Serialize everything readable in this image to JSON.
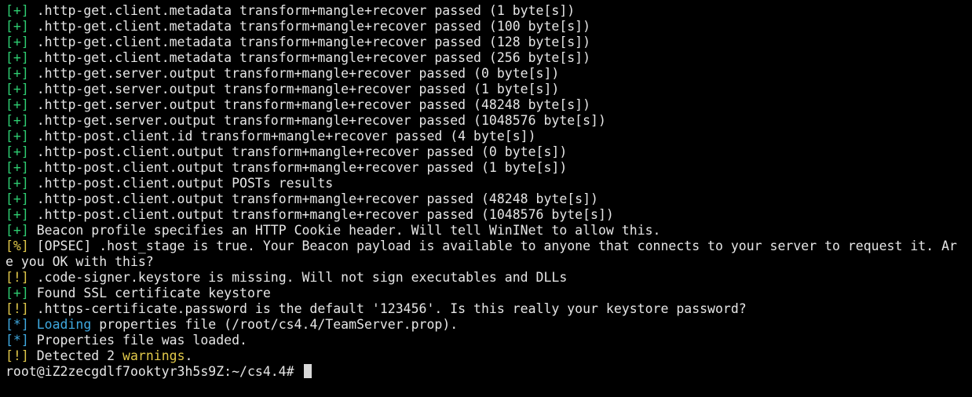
{
  "colors": {
    "background": "#000000",
    "text": "#e6e6e6",
    "plus_tag": "#2ecc71",
    "warning_tag": "#e0c84a",
    "info_tag": "#3fa9e0"
  },
  "lines": [
    {
      "tag": "[+]",
      "text": " .http-get.client.metadata transform+mangle+recover passed (1 byte[s])"
    },
    {
      "tag": "[+]",
      "text": " .http-get.client.metadata transform+mangle+recover passed (100 byte[s])"
    },
    {
      "tag": "[+]",
      "text": " .http-get.client.metadata transform+mangle+recover passed (128 byte[s])"
    },
    {
      "tag": "[+]",
      "text": " .http-get.client.metadata transform+mangle+recover passed (256 byte[s])"
    },
    {
      "tag": "[+]",
      "text": " .http-get.server.output transform+mangle+recover passed (0 byte[s])"
    },
    {
      "tag": "[+]",
      "text": " .http-get.server.output transform+mangle+recover passed (1 byte[s])"
    },
    {
      "tag": "[+]",
      "text": " .http-get.server.output transform+mangle+recover passed (48248 byte[s])"
    },
    {
      "tag": "[+]",
      "text": " .http-get.server.output transform+mangle+recover passed (1048576 byte[s])"
    },
    {
      "tag": "[+]",
      "text": " .http-post.client.id transform+mangle+recover passed (4 byte[s])"
    },
    {
      "tag": "[+]",
      "text": " .http-post.client.output transform+mangle+recover passed (0 byte[s])"
    },
    {
      "tag": "[+]",
      "text": " .http-post.client.output transform+mangle+recover passed (1 byte[s])"
    },
    {
      "tag": "[+]",
      "text": " .http-post.client.output POSTs results"
    },
    {
      "tag": "[+]",
      "text": " .http-post.client.output transform+mangle+recover passed (48248 byte[s])"
    },
    {
      "tag": "[+]",
      "text": " .http-post.client.output transform+mangle+recover passed (1048576 byte[s])"
    },
    {
      "tag": "[+]",
      "text": " Beacon profile specifies an HTTP Cookie header. Will tell WinINet to allow this."
    },
    {
      "tag": "[%]",
      "text": " [OPSEC] .host_stage is true. Your Beacon payload is available to anyone that connects to your server to request it. Ar"
    },
    {
      "tag": "",
      "text": "e you OK with this?"
    },
    {
      "tag": "[!]",
      "text": " .code-signer.keystore is missing. Will not sign executables and DLLs"
    },
    {
      "tag": "[+]",
      "text": " Found SSL certificate keystore"
    },
    {
      "tag": "[!]",
      "text": " .https-certificate.password is the default '123456'. Is this really your keystore password?"
    },
    {
      "tag": "[*]",
      "text_before": " ",
      "highlight": "Loading",
      "text": " properties file (/root/cs4.4/TeamServer.prop)."
    },
    {
      "tag": "[*]",
      "text": " Properties file was loaded."
    },
    {
      "tag": "[!]",
      "text_before": " Detected 2 ",
      "highlight": "warnings",
      "text": "."
    }
  ],
  "prompt": {
    "text": "root@iZ2zecgdlf7ooktyr3h5s9Z:~/cs4.4# "
  }
}
